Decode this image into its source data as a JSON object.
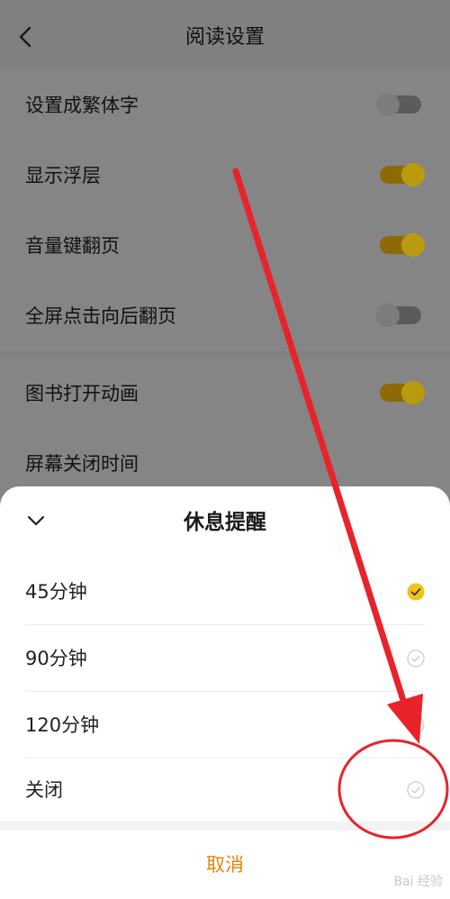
{
  "header": {
    "title": "阅读设置",
    "back_icon": "chevron-left-icon"
  },
  "settings": [
    {
      "label": "设置成繁体字",
      "toggle": "off"
    },
    {
      "label": "显示浮层",
      "toggle": "on"
    },
    {
      "label": "音量键翻页",
      "toggle": "on"
    },
    {
      "label": "全屏点击向后翻页",
      "toggle": "off"
    },
    {
      "label": "图书打开动画",
      "toggle": "on"
    },
    {
      "label": "屏幕关闭时间",
      "toggle": null
    }
  ],
  "sheet": {
    "title": "休息提醒",
    "collapse_icon": "chevron-down-icon",
    "options": [
      {
        "label": "45分钟",
        "selected": true
      },
      {
        "label": "90分钟",
        "selected": false
      },
      {
        "label": "120分钟",
        "selected": false
      },
      {
        "label": "关闭",
        "selected": false
      }
    ],
    "cancel_label": "取消"
  },
  "colors": {
    "accent": "#e8830c",
    "check_selected": "#f0c21b",
    "annotation": "#e8232a"
  },
  "watermark": "Bai 经验"
}
